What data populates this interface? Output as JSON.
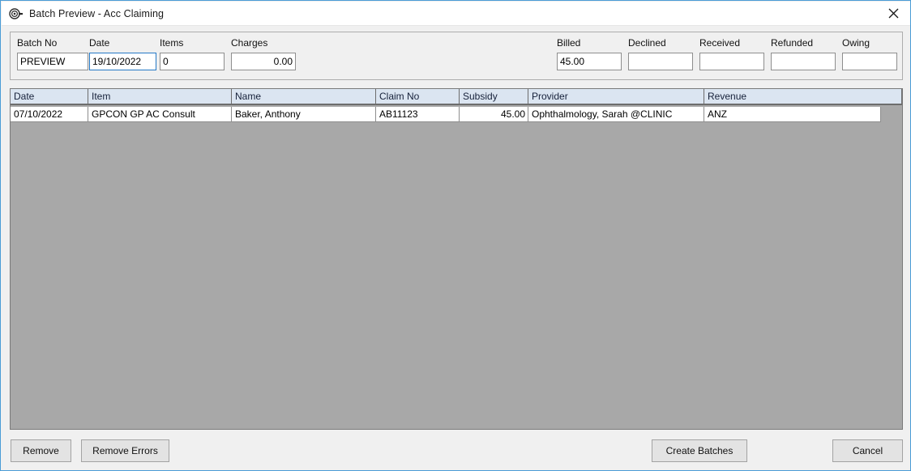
{
  "window": {
    "title": "Batch Preview - Acc Claiming",
    "icon": "batch-preview-icon",
    "close_label": "✕"
  },
  "form": {
    "fields": [
      {
        "label": "Batch No",
        "value": "PREVIEW",
        "align": "left",
        "focused": false
      },
      {
        "label": "Date",
        "value": "19/10/2022",
        "align": "left",
        "focused": true
      },
      {
        "label": "Items",
        "value": "0",
        "align": "left",
        "focused": false
      },
      {
        "label": "Charges",
        "value": "0.00",
        "align": "right",
        "focused": false
      },
      {
        "label": "Billed",
        "value": "45.00",
        "align": "left",
        "focused": false
      },
      {
        "label": "Declined",
        "value": "",
        "align": "left",
        "focused": false
      },
      {
        "label": "Received",
        "value": "",
        "align": "left",
        "focused": false
      },
      {
        "label": "Refunded",
        "value": "",
        "align": "left",
        "focused": false
      },
      {
        "label": "Owing",
        "value": "",
        "align": "left",
        "focused": false
      }
    ]
  },
  "grid": {
    "columns": [
      {
        "label": "Date"
      },
      {
        "label": "Item"
      },
      {
        "label": "Name"
      },
      {
        "label": "Claim No"
      },
      {
        "label": "Subsidy"
      },
      {
        "label": "Provider"
      },
      {
        "label": "Revenue"
      }
    ],
    "rows": [
      {
        "date": "07/10/2022",
        "item": "GPCON GP AC Consult",
        "name": "Baker, Anthony",
        "claim_no": "AB11123",
        "subsidy": "45.00",
        "provider": "Ophthalmology, Sarah @CLINIC",
        "revenue": "ANZ"
      }
    ]
  },
  "buttons": {
    "remove": "Remove",
    "remove_errors": "Remove Errors",
    "create_batches": "Create  Batches",
    "cancel": "Cancel"
  },
  "colors": {
    "window_border": "#4a9cd6",
    "panel_bg": "#f0f0f0",
    "grid_bg": "#a8a8a8",
    "header_bg": "#dbe5f1",
    "focus_border": "#2579c6"
  }
}
